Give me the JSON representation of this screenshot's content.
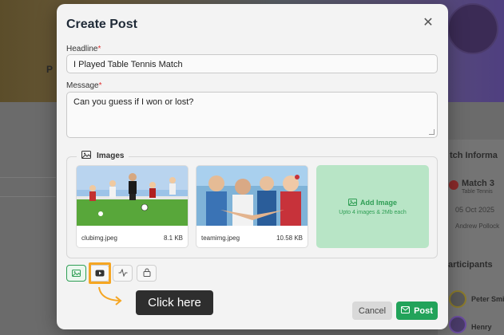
{
  "modal": {
    "title": "Create Post",
    "close_icon": "close-icon"
  },
  "form": {
    "headline_label": "Headline",
    "headline_value": "I Played Table Tennis Match",
    "message_label": "Message",
    "message_value": "Can you guess if I won or lost?",
    "required_mark": "*"
  },
  "images": {
    "legend": "Images",
    "items": [
      {
        "filename": "clubimg.jpeg",
        "size": "8.1 KB"
      },
      {
        "filename": "teamimg.jpeg",
        "size": "10.58 KB"
      }
    ],
    "add_label": "Add Image",
    "add_hint": "Upto 4 images & 2Mb each"
  },
  "toolbar": {
    "items": [
      {
        "name": "image",
        "icon": "image-icon",
        "active": true
      },
      {
        "name": "video",
        "icon": "video-icon",
        "active": false
      },
      {
        "name": "activity",
        "icon": "activity-icon",
        "active": false
      },
      {
        "name": "lock",
        "icon": "lock-icon",
        "active": false
      }
    ]
  },
  "callout": {
    "text": "Click here",
    "accent": "#f5a623"
  },
  "actions": {
    "cancel_label": "Cancel",
    "post_label": "Post"
  },
  "background": {
    "left_label": "P",
    "match_info": "tch Informa",
    "match_title": "Match 3",
    "match_sub": "Table Tennis",
    "match_date": "05 Oct 2025",
    "match_person": "Andrew Pollock",
    "participants": "articipants",
    "participant_1": "Peter Smit",
    "participant_2": "Henry"
  },
  "colors": {
    "primary": "#22a35a",
    "highlight": "#f5a623",
    "overlay": "#6d6d6d"
  }
}
